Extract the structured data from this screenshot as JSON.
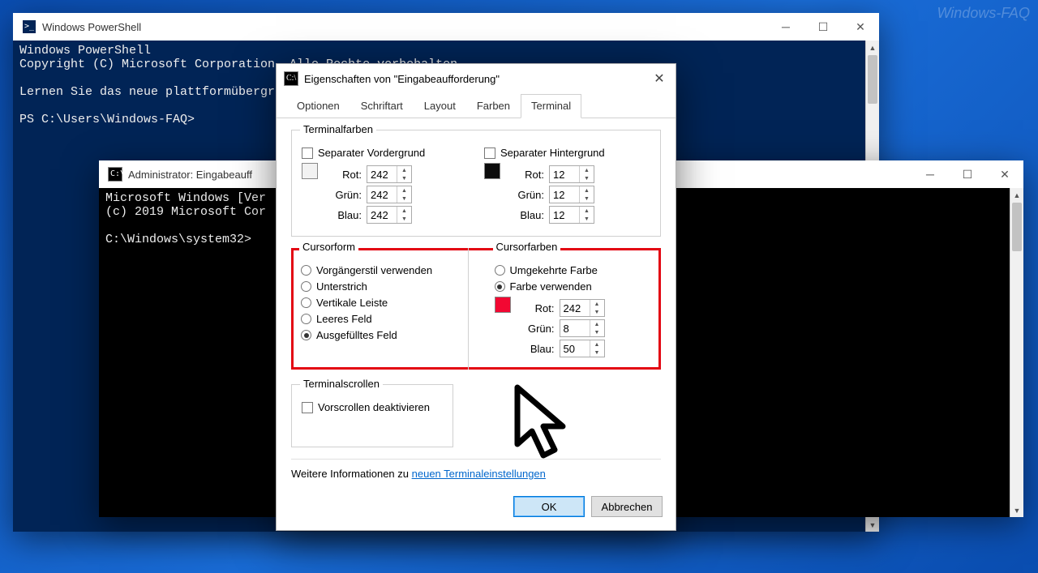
{
  "watermark": "Windows-FAQ",
  "ps_window": {
    "title": "Windows PowerShell",
    "lines": "Windows PowerShell\nCopyright (C) Microsoft Corporation. Alle Rechte vorbehalten.\n\nLernen Sie das neue plattformübergrei\n\nPS C:\\Users\\Windows-FAQ>"
  },
  "cmd_window": {
    "title": "Administrator: Eingabeauff",
    "lines": "Microsoft Windows [Ver\n(c) 2019 Microsoft Cor\n\nC:\\Windows\\system32>"
  },
  "dialog": {
    "title": "Eigenschaften von \"Eingabeaufforderung\"",
    "tabs": [
      "Optionen",
      "Schriftart",
      "Layout",
      "Farben",
      "Terminal"
    ],
    "active_tab": 4,
    "terminal_colors": {
      "legend": "Terminalfarben",
      "sep_fg_label": "Separater Vordergrund",
      "sep_bg_label": "Separater Hintergrund",
      "labels": {
        "r": "Rot:",
        "g": "Grün:",
        "b": "Blau:"
      },
      "fg_swatch": "#f2f2f2",
      "bg_swatch": "#0c0c0c",
      "fg": {
        "r": "242",
        "g": "242",
        "b": "242"
      },
      "bg": {
        "r": "12",
        "g": "12",
        "b": "12"
      }
    },
    "cursor_shape": {
      "legend": "Cursorform",
      "options": [
        "Vorgängerstil verwenden",
        "Unterstrich",
        "Vertikale Leiste",
        "Leeres Feld",
        "Ausgefülltes Feld"
      ],
      "selected": 4
    },
    "cursor_colors": {
      "legend": "Cursorfarben",
      "options": [
        "Umgekehrte Farbe",
        "Farbe verwenden"
      ],
      "selected": 1,
      "swatch": "#f20832",
      "labels": {
        "r": "Rot:",
        "g": "Grün:",
        "b": "Blau:"
      },
      "rgb": {
        "r": "242",
        "g": "8",
        "b": "50"
      }
    },
    "terminal_scroll": {
      "legend": "Terminalscrollen",
      "disable_label": "Vorscrollen deaktivieren"
    },
    "more_info_prefix": "Weitere Informationen zu ",
    "more_info_link": "neuen Terminaleinstellungen",
    "buttons": {
      "ok": "OK",
      "cancel": "Abbrechen"
    }
  }
}
